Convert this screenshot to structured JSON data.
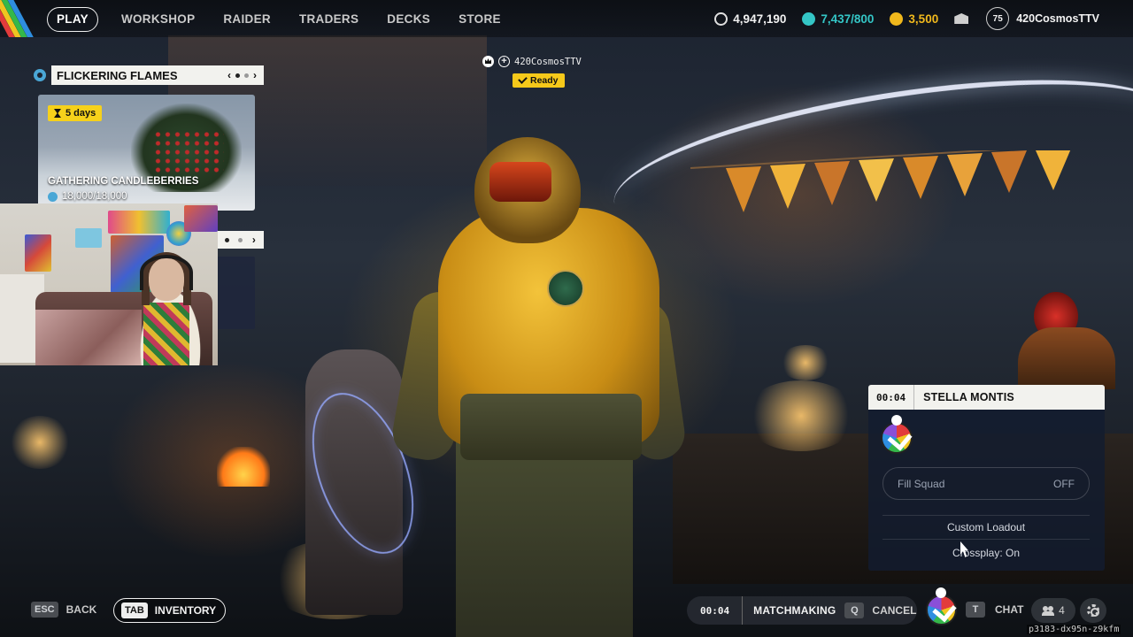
{
  "nav": {
    "items": [
      {
        "label": "PLAY",
        "active": true
      },
      {
        "label": "WORKSHOP",
        "active": false
      },
      {
        "label": "RAIDER",
        "active": false
      },
      {
        "label": "TRADERS",
        "active": false
      },
      {
        "label": "DECKS",
        "active": false
      },
      {
        "label": "STORE",
        "active": false
      }
    ]
  },
  "currencies": {
    "coins": {
      "value": "4,947,190",
      "icon": "coin-icon",
      "color": "#e0e0e0"
    },
    "credits": {
      "value": "7,437/800",
      "icon": "credit-icon",
      "color": "#34c6c6"
    },
    "tokens": {
      "value": "3,500",
      "icon": "token-icon",
      "color": "#f0b81c"
    }
  },
  "profile": {
    "level": "75",
    "username": "420CosmosTTV"
  },
  "event": {
    "title": "FLICKERING FLAMES",
    "prev": "‹",
    "next": "›",
    "card": {
      "timer": "5 days",
      "title": "GATHERING CANDLEBERRIES",
      "progress": "18,000/18,000",
      "progress_fraction": 1.0
    }
  },
  "lobby": {
    "player_name": "420CosmosTTV",
    "ready_label": "Ready",
    "plus": "+"
  },
  "squad": {
    "timer": "00:04",
    "map_name": "STELLA MONTIS",
    "fill_squad_label": "Fill Squad",
    "fill_squad_value": "OFF",
    "custom_loadout": "Custom Loadout",
    "crossplay": "Crossplay: On"
  },
  "bottom": {
    "back_key": "ESC",
    "back_label": "BACK",
    "inventory_key": "TAB",
    "inventory_label": "INVENTORY",
    "mm_timer": "00:04",
    "mm_label": "MATCHMAKING",
    "cancel_key": "Q",
    "cancel_label": "CANCEL",
    "chat_key": "T",
    "chat_label": "CHAT",
    "friends_count": "4",
    "session_id": "p3183-dx95n-z9kfm"
  },
  "colors": {
    "accent_yellow": "#f6c91a",
    "panel_light": "#f2f2ee",
    "panel_dark": "#121c30"
  }
}
